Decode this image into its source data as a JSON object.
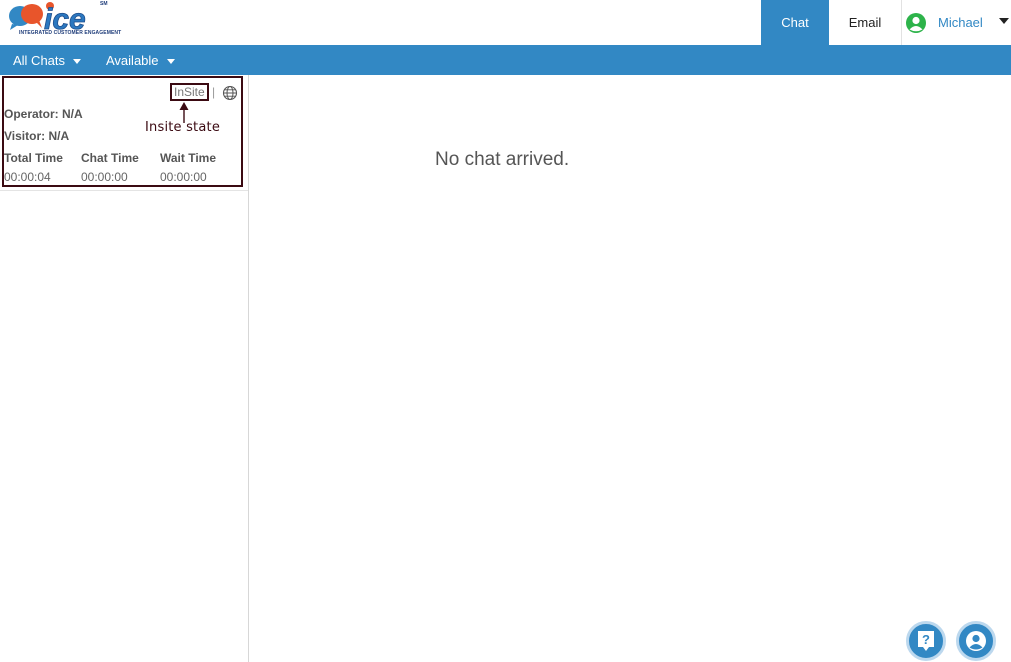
{
  "logo": {
    "wordmark": "ice",
    "trademark": "SM",
    "tagline": "INTEGRATED CUSTOMER ENGAGEMENT"
  },
  "header": {
    "tabs": [
      {
        "label": "Chat",
        "active": true
      },
      {
        "label": "Email",
        "active": false
      }
    ],
    "user": {
      "name": "Michael",
      "status_color": "#2db34a"
    }
  },
  "subnav": {
    "chats_filter": "All Chats",
    "availability": "Available"
  },
  "chat_card": {
    "state": "InSite",
    "separator": "|",
    "annotation": "Insite state",
    "operator": "Operator: N/A",
    "visitor": "Visitor: N/A",
    "columns": [
      {
        "label": "Total Time",
        "value": "00:00:04"
      },
      {
        "label": "Chat Time",
        "value": "00:00:00"
      },
      {
        "label": "Wait Time",
        "value": "00:00:00"
      }
    ]
  },
  "main": {
    "empty_message": "No chat arrived."
  },
  "fabs": [
    {
      "icon": "help-icon"
    },
    {
      "icon": "user-profile-icon"
    }
  ],
  "colors": {
    "brand_blue": "#3288c4",
    "annotation": "#3b0a12"
  }
}
